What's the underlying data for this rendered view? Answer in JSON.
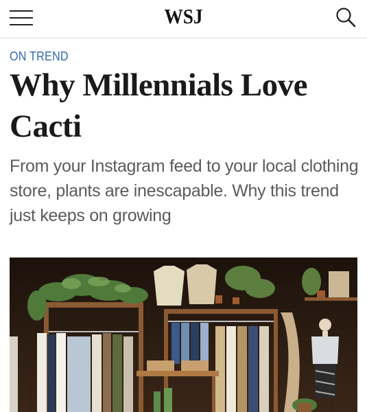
{
  "header": {
    "logo": "WSJ",
    "menu_icon": "hamburger-menu-icon",
    "search_icon": "search-icon"
  },
  "article": {
    "kicker": "ON TREND",
    "headline": "Why Millennials Love Cacti",
    "subheadline": "From your Instagram feed to your local clothing store, plants are inescapable. Why this trend just keeps on growing"
  },
  "colors": {
    "kicker": "#2f6aa5",
    "headline": "#1a1a1a",
    "subheadline": "#5b5b5b"
  }
}
